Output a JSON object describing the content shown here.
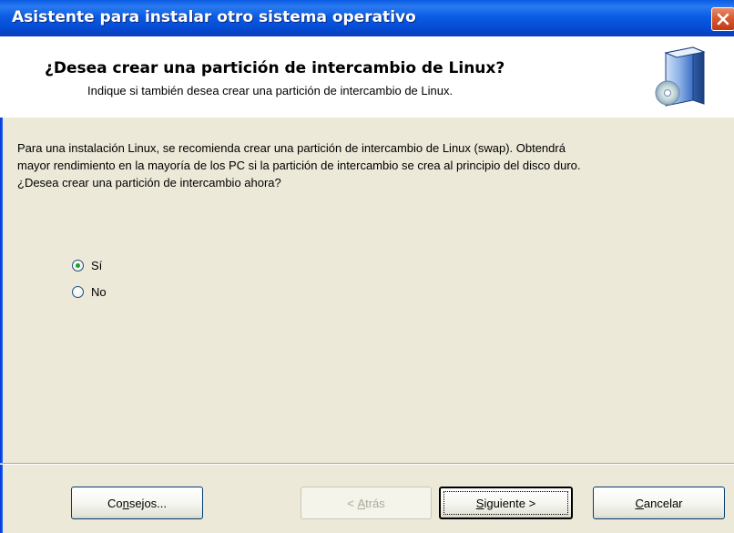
{
  "window": {
    "title": "Asistente para instalar otro sistema operativo",
    "close_icon": "close-icon"
  },
  "header": {
    "title": "¿Desea crear una partición de intercambio de Linux?",
    "subtitle": "Indique si también desea crear una partición de intercambio de Linux.",
    "icon": "computer-cd-icon"
  },
  "body": {
    "description": "Para una instalación Linux, se recomienda crear una partición de intercambio de Linux (swap). Obtendrá mayor rendimiento en la mayoría de los PC si la partición de intercambio se crea al principio del disco duro. ¿Desea crear una partición de intercambio ahora?",
    "options": [
      {
        "label": "Sí",
        "checked": true
      },
      {
        "label": "No",
        "checked": false
      }
    ]
  },
  "buttons": {
    "consejos": {
      "pre": "Co",
      "mnemonic": "n",
      "post": "sejos..."
    },
    "atras": {
      "pre": "< ",
      "mnemonic": "A",
      "post": "trás"
    },
    "siguiente": {
      "pre": "",
      "mnemonic": "S",
      "post": "iguiente >"
    },
    "cancelar": {
      "pre": "",
      "mnemonic": "C",
      "post": "ancelar"
    }
  },
  "colors": {
    "titlebar": "#0a5be3",
    "dialog_bg": "#ece9d8",
    "header_bg": "#ffffff",
    "radio_dot": "#21a121"
  }
}
